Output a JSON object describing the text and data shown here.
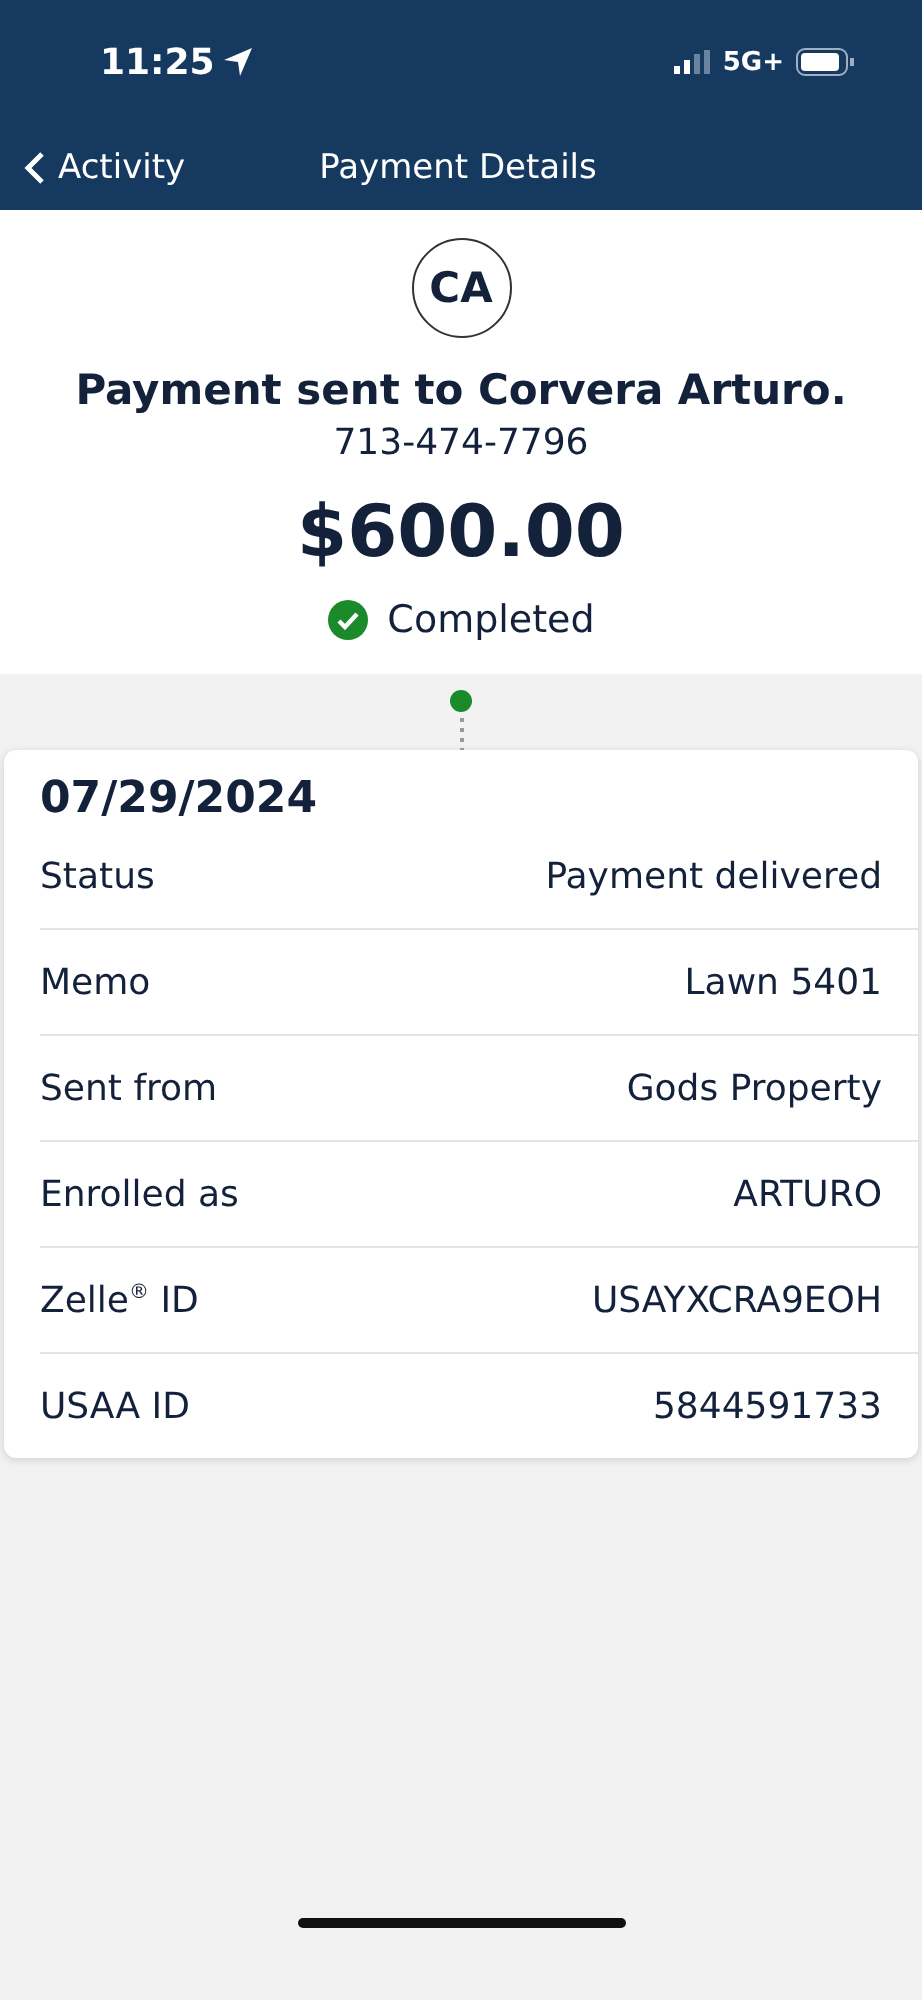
{
  "status_bar": {
    "time": "11:25",
    "network": "5G+"
  },
  "nav": {
    "back_label": "Activity",
    "title": "Payment Details"
  },
  "summary": {
    "initials": "CA",
    "headline": "Payment sent to Corvera Arturo.",
    "phone": "713-474-7796",
    "amount": "$600.00",
    "status": {
      "label": "Completed",
      "color": "#1a8a2a"
    }
  },
  "details": {
    "date": "07/29/2024",
    "rows": [
      {
        "label": "Status",
        "value": "Payment delivered"
      },
      {
        "label": "Memo",
        "value": "Lawn 5401"
      },
      {
        "label": "Sent from",
        "value": "Gods Property"
      },
      {
        "label": "Enrolled as",
        "value": "ARTURO"
      },
      {
        "label": "Zelle$^{®}$ ID",
        "value": "USAYXCRA9EOH"
      },
      {
        "label": "USAA ID",
        "value": "5844591733"
      }
    ]
  }
}
